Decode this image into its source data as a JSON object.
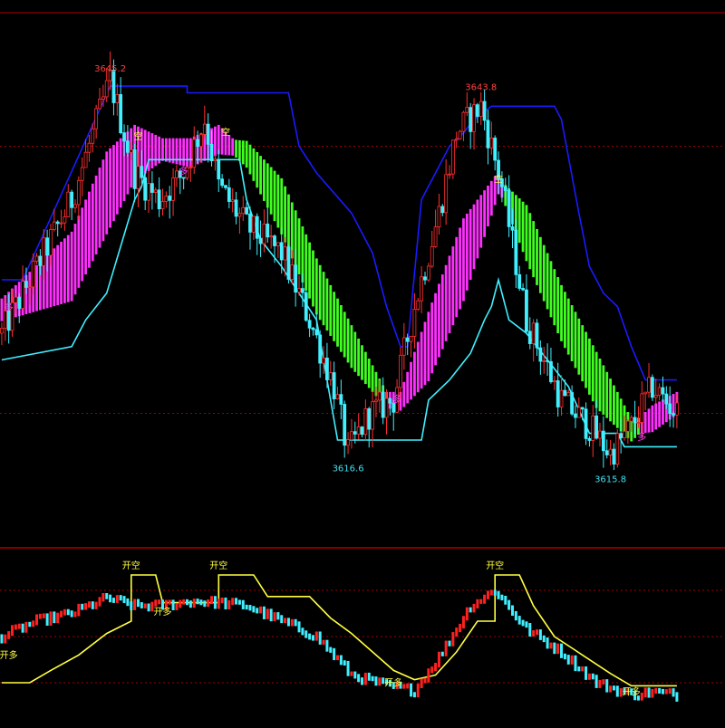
{
  "chart_data": [
    {
      "type": "candlestick",
      "panel": "main",
      "ylim": [
        3610,
        3650
      ],
      "x_count": 200,
      "reference_levels": [
        3640,
        3620
      ],
      "annotations": [
        {
          "label": "3645.2",
          "x": 31,
          "y": 3645.2,
          "color": "#ff4040",
          "where": "above"
        },
        {
          "label": "3643.8",
          "x": 137,
          "y": 3643.8,
          "color": "#ff4040",
          "where": "above"
        },
        {
          "label": "3616.6",
          "x": 99,
          "y": 3616.6,
          "color": "#40e0f0",
          "where": "below"
        },
        {
          "label": "3615.8",
          "x": 174,
          "y": 3615.8,
          "color": "#40e0f0",
          "where": "below"
        }
      ],
      "signals": [
        {
          "label": "空",
          "x": 39,
          "y": 3640.5,
          "color": "#ffff40"
        },
        {
          "label": "多",
          "x": 52,
          "y": 3637.9,
          "color": "#ff40ff"
        },
        {
          "label": "空",
          "x": 64,
          "y": 3640.8,
          "color": "#ffff40"
        },
        {
          "label": "空",
          "x": 142,
          "y": 3637.3,
          "color": "#ffff40"
        },
        {
          "label": "多",
          "x": 113,
          "y": 3620.8,
          "color": "#ff40ff"
        },
        {
          "label": "多",
          "x": 183,
          "y": 3618.0,
          "color": "#ff40ff"
        },
        {
          "label": "多",
          "x": 2,
          "y": 3627.7,
          "color": "#ff40ff"
        }
      ],
      "price_path": [
        [
          0,
          3626
        ],
        [
          10,
          3631
        ],
        [
          20,
          3636
        ],
        [
          31,
          3645
        ],
        [
          38,
          3638
        ],
        [
          45,
          3636
        ],
        [
          52,
          3638
        ],
        [
          58,
          3642
        ],
        [
          62,
          3637
        ],
        [
          70,
          3634
        ],
        [
          80,
          3632
        ],
        [
          88,
          3627
        ],
        [
          95,
          3622
        ],
        [
          99,
          3617
        ],
        [
          105,
          3620
        ],
        [
          112,
          3621
        ],
        [
          118,
          3628
        ],
        [
          125,
          3635
        ],
        [
          130,
          3641
        ],
        [
          137,
          3643
        ],
        [
          143,
          3637
        ],
        [
          150,
          3627
        ],
        [
          160,
          3621
        ],
        [
          168,
          3619
        ],
        [
          174,
          3617
        ],
        [
          180,
          3619
        ],
        [
          186,
          3622
        ],
        [
          193,
          3620
        ]
      ],
      "upper_channel": [
        [
          0,
          3630
        ],
        [
          6,
          3630
        ],
        [
          6,
          3630
        ],
        [
          31,
          3644.5
        ],
        [
          53,
          3644.5
        ],
        [
          53,
          3644
        ],
        [
          82,
          3644
        ],
        [
          85,
          3640
        ],
        [
          90,
          3638
        ],
        [
          100,
          3635
        ],
        [
          106,
          3632
        ],
        [
          110,
          3628
        ],
        [
          114,
          3625
        ],
        [
          116,
          3625
        ],
        [
          120,
          3636
        ],
        [
          124,
          3638
        ],
        [
          128,
          3640
        ],
        [
          132,
          3641
        ],
        [
          135,
          3642
        ],
        [
          140,
          3643
        ],
        [
          158,
          3643
        ],
        [
          160,
          3642
        ],
        [
          165,
          3635
        ],
        [
          168,
          3631
        ],
        [
          172,
          3629
        ],
        [
          176,
          3628
        ],
        [
          180,
          3625
        ],
        [
          184,
          3622.5
        ],
        [
          193,
          3622.5
        ]
      ],
      "lower_channel": [
        [
          0,
          3624
        ],
        [
          20,
          3625
        ],
        [
          24,
          3627
        ],
        [
          30,
          3629
        ],
        [
          38,
          3636
        ],
        [
          40,
          3637
        ],
        [
          42,
          3639
        ],
        [
          68,
          3639
        ],
        [
          70,
          3636
        ],
        [
          74,
          3633
        ],
        [
          80,
          3631
        ],
        [
          90,
          3627
        ],
        [
          96,
          3618
        ],
        [
          120,
          3618
        ],
        [
          122,
          3621
        ],
        [
          128,
          3622.5
        ],
        [
          134,
          3624.5
        ],
        [
          138,
          3627
        ],
        [
          140,
          3628
        ],
        [
          142,
          3630
        ],
        [
          145,
          3627
        ],
        [
          150,
          3626
        ],
        [
          156,
          3624
        ],
        [
          162,
          3622
        ],
        [
          168,
          3618.5
        ],
        [
          176,
          3618.5
        ],
        [
          178,
          3617.5
        ],
        [
          193,
          3617.5
        ]
      ],
      "ribbon": {
        "bull_color": "#ff30ff",
        "bear_color": "#40ff20",
        "fast": [
          [
            0,
            3628
          ],
          [
            20,
            3633
          ],
          [
            30,
            3639
          ],
          [
            38,
            3641
          ],
          [
            46,
            3640
          ],
          [
            54,
            3640
          ],
          [
            62,
            3641
          ],
          [
            70,
            3639
          ],
          [
            80,
            3634
          ],
          [
            90,
            3628
          ],
          [
            100,
            3624
          ],
          [
            110,
            3621
          ],
          [
            114,
            3621
          ],
          [
            122,
            3627
          ],
          [
            132,
            3634
          ],
          [
            142,
            3637.5
          ],
          [
            150,
            3632
          ],
          [
            160,
            3626
          ],
          [
            170,
            3621
          ],
          [
            180,
            3618.5
          ],
          [
            186,
            3620
          ],
          [
            193,
            3621
          ]
        ],
        "slow": [
          [
            0,
            3627.5
          ],
          [
            20,
            3629
          ],
          [
            30,
            3634
          ],
          [
            38,
            3638
          ],
          [
            46,
            3639.5
          ],
          [
            54,
            3639
          ],
          [
            62,
            3640
          ],
          [
            70,
            3639.8
          ],
          [
            80,
            3637
          ],
          [
            90,
            3631
          ],
          [
            100,
            3626
          ],
          [
            110,
            3621
          ],
          [
            114,
            3620.8
          ],
          [
            122,
            3623
          ],
          [
            132,
            3629
          ],
          [
            142,
            3637
          ],
          [
            150,
            3635
          ],
          [
            160,
            3629
          ],
          [
            170,
            3624
          ],
          [
            180,
            3619
          ],
          [
            186,
            3619.2
          ],
          [
            193,
            3620.5
          ]
        ]
      }
    },
    {
      "type": "line",
      "panel": "indicator",
      "ylim": [
        0,
        100
      ],
      "reference_levels": [
        80,
        50,
        20
      ],
      "series": [
        {
          "color": "#ffff40",
          "points": [
            [
              0,
              20
            ],
            [
              8,
              20
            ],
            [
              14,
              28
            ],
            [
              22,
              38
            ],
            [
              30,
              52
            ],
            [
              37,
              60
            ],
            [
              37,
              90
            ],
            [
              44,
              90
            ],
            [
              46,
              72
            ],
            [
              58,
              72
            ],
            [
              62,
              72
            ],
            [
              62,
              90
            ],
            [
              72,
              90
            ],
            [
              76,
              76
            ],
            [
              88,
              76
            ],
            [
              94,
              62
            ],
            [
              100,
              52
            ],
            [
              106,
              40
            ],
            [
              112,
              28
            ],
            [
              118,
              22
            ],
            [
              124,
              25
            ],
            [
              130,
              40
            ],
            [
              136,
              60
            ],
            [
              141,
              60
            ],
            [
              141,
              90
            ],
            [
              148,
              90
            ],
            [
              152,
              70
            ],
            [
              158,
              50
            ],
            [
              166,
              38
            ],
            [
              174,
              26
            ],
            [
              180,
              18
            ],
            [
              186,
              18
            ],
            [
              193,
              18
            ]
          ]
        },
        {
          "color": "#40f0ff",
          "points": [
            [
              0,
              50
            ],
            [
              10,
              60
            ],
            [
              20,
              65
            ],
            [
              30,
              75
            ],
            [
              38,
              70
            ],
            [
              45,
              70
            ],
            [
              55,
              73
            ],
            [
              62,
              72
            ],
            [
              70,
              70
            ],
            [
              80,
              60
            ],
            [
              90,
              50
            ],
            [
              100,
              25
            ],
            [
              110,
              18
            ],
            [
              118,
              15
            ],
            [
              126,
              40
            ],
            [
              134,
              70
            ],
            [
              141,
              80
            ],
            [
              150,
              55
            ],
            [
              160,
              40
            ],
            [
              170,
              20
            ],
            [
              180,
              12
            ],
            [
              186,
              14
            ],
            [
              193,
              12
            ]
          ]
        }
      ],
      "annotations": [
        {
          "label": "开空",
          "x": 37,
          "y": 94,
          "color": "#ffff40"
        },
        {
          "label": "开空",
          "x": 62,
          "y": 94,
          "color": "#ffff40"
        },
        {
          "label": "开空",
          "x": 141,
          "y": 94,
          "color": "#ffff40"
        },
        {
          "label": "开多",
          "x": 2,
          "y": 36,
          "color": "#ffff40"
        },
        {
          "label": "开多",
          "x": 46,
          "y": 64,
          "color": "#ffff40"
        },
        {
          "label": "开多",
          "x": 112,
          "y": 18,
          "color": "#ffff40"
        },
        {
          "label": "开多",
          "x": 180,
          "y": 12,
          "color": "#ffff40"
        }
      ]
    }
  ]
}
